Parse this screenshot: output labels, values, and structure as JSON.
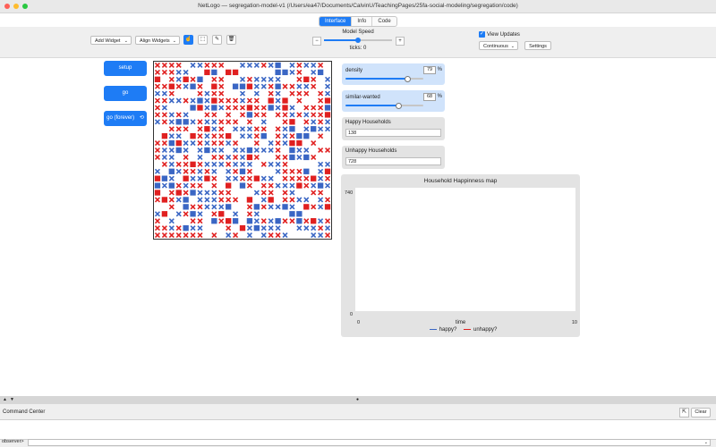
{
  "window": {
    "title": "NetLogo — segregation-model-v1 (/Users/ea47/Documents/CalvinU/TeachingPages/25fa-social-modeling/segregation/code)"
  },
  "tabs": [
    {
      "label": "Interface",
      "active": true
    },
    {
      "label": "Info",
      "active": false
    },
    {
      "label": "Code",
      "active": false
    }
  ],
  "toolbar": {
    "add_widget": "Add Widget",
    "align_widgets": "Align Widgets",
    "model_speed_label": "Model Speed",
    "ticks_label": "ticks: 0",
    "view_updates_label": "View Updates",
    "view_updates_checked": true,
    "update_mode": "Continuous",
    "settings_label": "Settings",
    "speed_minus": "−",
    "speed_plus": "+",
    "model_speed_value": 0.5
  },
  "buttons": {
    "setup": "setup",
    "go": "go",
    "go_forever": "go (forever)",
    "forever_icon": "⟲"
  },
  "sliders": [
    {
      "name": "density",
      "value": "79",
      "unit": "%",
      "fraction": 0.79
    },
    {
      "name": "similar-wanted",
      "value": "68",
      "unit": "%",
      "fraction": 0.68
    }
  ],
  "monitors": [
    {
      "label": "Happy Households",
      "value": "138"
    },
    {
      "label": "Unhappy Households",
      "value": "728"
    }
  ],
  "plot": {
    "title": "Household Happinness map",
    "ymax": "740",
    "ymin": "0",
    "xmin": "0",
    "xmax": "10",
    "xlabel": "time",
    "legend": [
      {
        "name": "happy?",
        "color": "#3a66c4"
      },
      {
        "name": "unhappy?",
        "color": "#e02020"
      }
    ]
  },
  "world": {
    "grid_size": 25,
    "density": 0.79,
    "colors": {
      "blue": "#3a66c4",
      "red": "#e02020"
    },
    "icons": {
      "happy": "square",
      "unhappy": "x-mark"
    }
  },
  "command_center": {
    "title": "Command Center",
    "clear_label": "Clear",
    "observer_label": "observer>"
  },
  "colors": {
    "accent": "#1e7cf5",
    "slider_bg": "#d0e3fb"
  }
}
